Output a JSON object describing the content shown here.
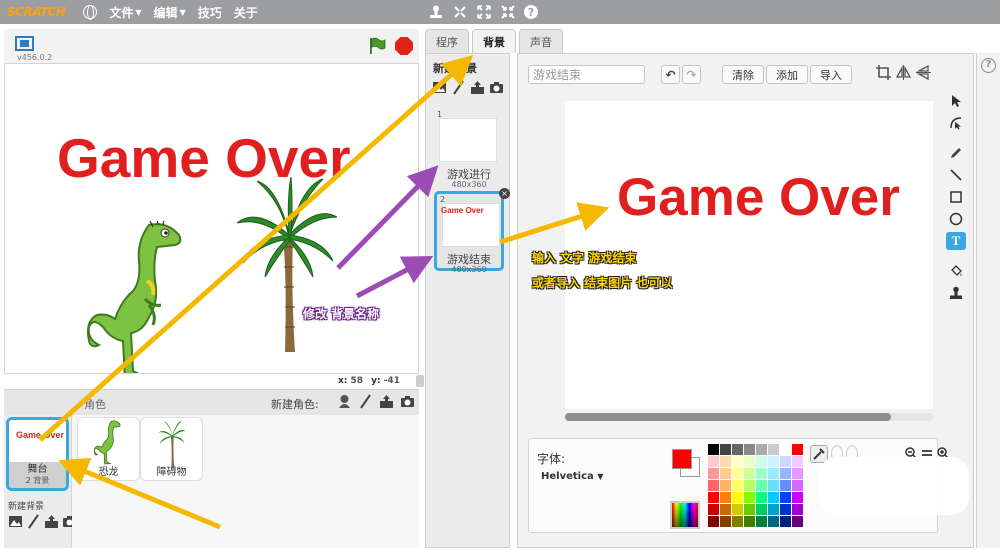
{
  "menubar": {
    "logo": "SCRATCH",
    "file": "文件",
    "edit": "编辑",
    "tips": "技巧",
    "about": "关于"
  },
  "stage": {
    "version": "v456.0.2",
    "text": "Game Over",
    "x_label": "x:",
    "x_value": "58",
    "y_label": "y:",
    "y_value": "-41"
  },
  "sprites": {
    "header_label": "角色",
    "new_sprite_label": "新建角色:",
    "items": [
      {
        "name": "恐龙"
      },
      {
        "name": "障碍物"
      }
    ],
    "stage_thumb": {
      "mini_text": "Game Over",
      "name": "舞台",
      "sub": "2 背景"
    },
    "new_backdrop_label": "新建背景"
  },
  "tabs": [
    {
      "label": "程序"
    },
    {
      "label": "背景"
    },
    {
      "label": "声音"
    }
  ],
  "backdrops": {
    "new_title": "新建背景",
    "items": [
      {
        "num": "1",
        "name": "游戏进行",
        "size": "480x360"
      },
      {
        "num": "2",
        "name": "游戏结束",
        "size": "480x360",
        "mini_text": "Game Over"
      }
    ]
  },
  "editor": {
    "name_value": "游戏结束",
    "clear_label": "清除",
    "add_label": "添加",
    "import_label": "导入",
    "canvas_text": "Game Over",
    "font_label": "字体:",
    "font_value": "Helvetica",
    "primary_color": "#ff0000",
    "text_tool": "T"
  },
  "annotations": {
    "rename": "修改 背景名称",
    "input_text": "输入 文字 游戏结束",
    "import_image": "或者导入 结束图片 也可以"
  },
  "colors": {
    "arrow_yellow": "#f5b800",
    "arrow_purple": "#9b4cb5",
    "selection_blue": "#3aa8e0",
    "game_over_red": "#e21f1f"
  },
  "palette": [
    "#000000",
    "#444444",
    "#666666",
    "#888888",
    "#aaaaaa",
    "#cccccc",
    "#ffffff",
    "#ff0000",
    "#ffcccc",
    "#ffd9b3",
    "#ffffcc",
    "#e6ffcc",
    "#ccffe6",
    "#ccf2ff",
    "#ccd9ff",
    "#f2ccff",
    "#ff9999",
    "#ffcc99",
    "#ffff99",
    "#ccff99",
    "#99ffcc",
    "#99ebff",
    "#99b3ff",
    "#e699ff",
    "#ff6666",
    "#ffb366",
    "#ffff66",
    "#b3ff66",
    "#66ffb3",
    "#66e0ff",
    "#668cff",
    "#d966ff",
    "#ff0000",
    "#ff8000",
    "#ffff00",
    "#80ff00",
    "#00ff80",
    "#00ccff",
    "#0040ff",
    "#cc00ff",
    "#cc0000",
    "#cc6600",
    "#cccc00",
    "#66cc00",
    "#00cc66",
    "#00a3cc",
    "#0033cc",
    "#a300cc",
    "#800000",
    "#804000",
    "#808000",
    "#408000",
    "#008040",
    "#006680",
    "#002080",
    "#660080"
  ]
}
